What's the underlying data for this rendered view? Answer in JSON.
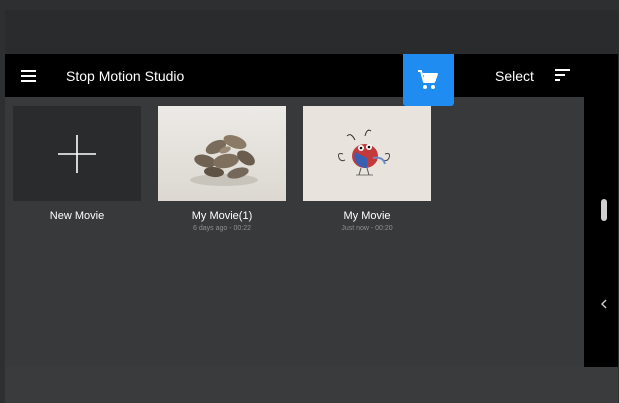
{
  "toolbar": {
    "title": "Stop Motion Studio",
    "menu_icon": "hamburger-menu-icon",
    "cart_icon": "shopping-cart-icon",
    "select_label": "Select",
    "sort_icon": "sort-icon"
  },
  "movies": [
    {
      "title": "New Movie",
      "subtitle": "",
      "thumbnail": "plus-icon"
    },
    {
      "title": "My Movie(1)",
      "subtitle": "6 days ago - 00:22",
      "thumbnail": "rocks-photo"
    },
    {
      "title": "My Movie",
      "subtitle": "Just now - 00:20",
      "thumbnail": "clay-bird-photo"
    }
  ],
  "sidebar": {
    "collapse_icon": "chevron-left-icon"
  },
  "colors": {
    "accent": "#1f8cf2",
    "toolbar_bg": "#000000",
    "content_bg": "#38393b",
    "new_tile_bg": "#2a2b2d"
  }
}
